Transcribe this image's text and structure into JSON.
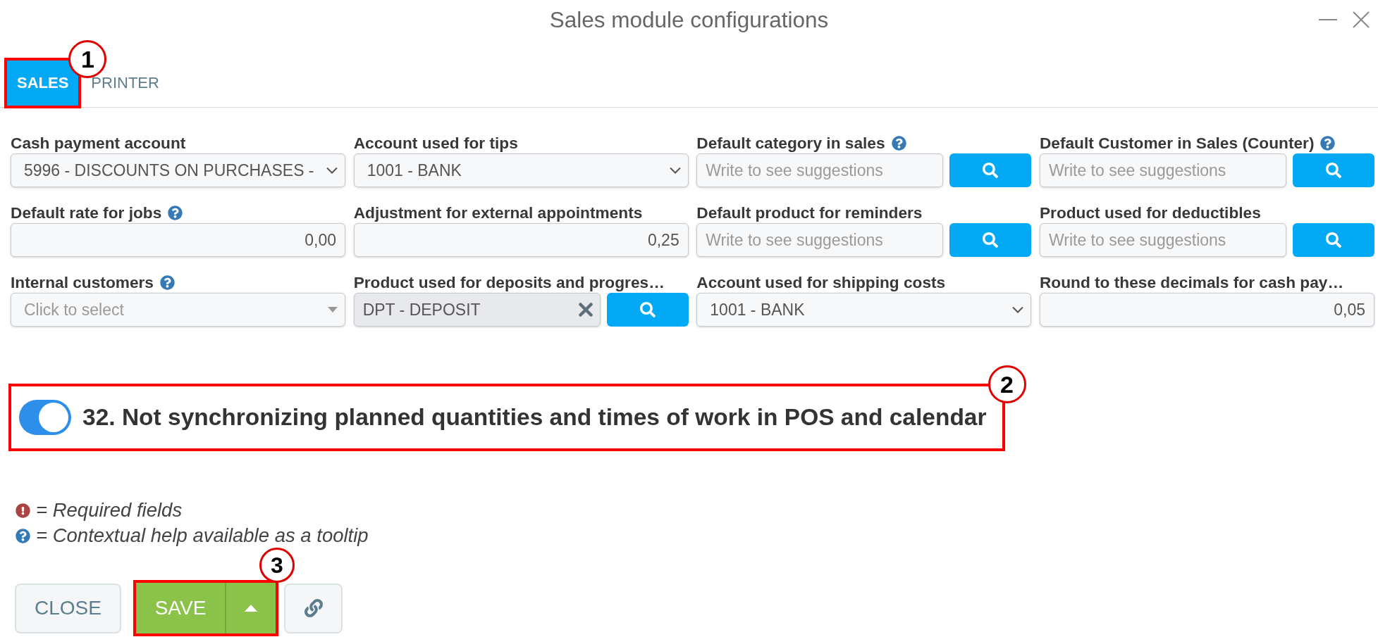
{
  "window": {
    "title": "Sales module configurations"
  },
  "tabs": [
    {
      "label": "SALES",
      "selected": true,
      "callout": "1"
    },
    {
      "label": "PRINTER",
      "selected": false
    }
  ],
  "fields": [
    {
      "kind": "select",
      "label": "Cash payment account",
      "help": false,
      "value": "5996 - DISCOUNTS ON PURCHASES -"
    },
    {
      "kind": "select",
      "label": "Account used for tips",
      "help": false,
      "value": "1001 - BANK"
    },
    {
      "kind": "lookup",
      "label": "Default category in sales",
      "help": true,
      "placeholder": "Write to see suggestions"
    },
    {
      "kind": "lookup",
      "label": "Default Customer in Sales (Counter)",
      "help": true,
      "placeholder": "Write to see suggestions"
    },
    {
      "kind": "number",
      "label": "Default rate for jobs",
      "help": true,
      "value": "0,00"
    },
    {
      "kind": "number",
      "label": "Adjustment for external appointments",
      "help": false,
      "value": "0,25"
    },
    {
      "kind": "lookup",
      "label": "Default product for reminders",
      "help": false,
      "placeholder": "Write to see suggestions"
    },
    {
      "kind": "lookup",
      "label": "Product used for deductibles",
      "help": false,
      "placeholder": "Write to see suggestions"
    },
    {
      "kind": "multiselect",
      "label": "Internal customers",
      "help": true,
      "placeholder": "Click to select"
    },
    {
      "kind": "lookup",
      "label": "Product used for deposits and progres…",
      "help": false,
      "value": "DPT - DEPOSIT"
    },
    {
      "kind": "select",
      "label": "Account used for shipping costs",
      "help": false,
      "value": "1001 - BANK"
    },
    {
      "kind": "number",
      "label": "Round to these decimals for cash pay…",
      "help": false,
      "value": "0,05"
    }
  ],
  "toggle": {
    "label": "32. Not synchronizing planned quantities and times of work in POS and calendar",
    "on": true,
    "callout": "2"
  },
  "legend": [
    {
      "kind": "required",
      "text": "= Required fields"
    },
    {
      "kind": "help",
      "text": "= Contextual help available as a tooltip"
    }
  ],
  "actions": [
    {
      "kind": "close",
      "label": "CLOSE"
    },
    {
      "kind": "save",
      "label": "SAVE",
      "callout": "3"
    },
    {
      "kind": "link"
    }
  ]
}
